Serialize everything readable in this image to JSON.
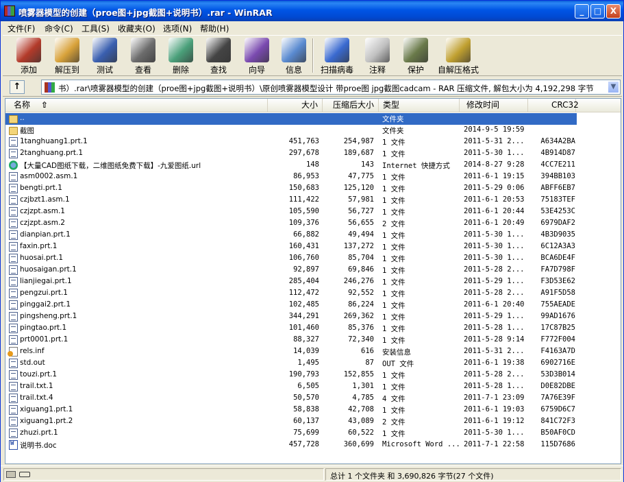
{
  "window": {
    "title": "喷雾器模型的创建（proe图+jpg截图+说明书）.rar - WinRAR",
    "min_label": "_",
    "max_label": "□",
    "close_label": "X"
  },
  "menu": [
    "文件(F)",
    "命令(C)",
    "工具(S)",
    "收藏夹(O)",
    "选项(N)",
    "帮助(H)"
  ],
  "toolbar": {
    "buttons": [
      {
        "label": "添加",
        "icon": "add-books-icon",
        "color": "#b33a2a"
      },
      {
        "label": "解压到",
        "icon": "extract-folder-icon",
        "color": "#d8a23a"
      },
      {
        "label": "测试",
        "icon": "test-clipboard-icon",
        "color": "#3a5fb0"
      },
      {
        "label": "查看",
        "icon": "view-glasses-icon",
        "color": "#6c6c6c"
      },
      {
        "label": "删除",
        "icon": "delete-box-icon",
        "color": "#4aa07a"
      },
      {
        "label": "查找",
        "icon": "find-binoculars-icon",
        "color": "#444444"
      },
      {
        "label": "向导",
        "icon": "wizard-icon",
        "color": "#7a4ab0"
      },
      {
        "label": "信息",
        "icon": "info-icon",
        "color": "#5a8ad0"
      },
      {
        "label": "扫描病毒",
        "icon": "virus-scan-icon",
        "color": "#3a6ad0"
      },
      {
        "label": "注释",
        "icon": "comment-pen-icon",
        "color": "#c0c0c0"
      },
      {
        "label": "保护",
        "icon": "protect-shield-icon",
        "color": "#6a7a4a"
      },
      {
        "label": "自解压格式",
        "icon": "sfx-books-icon",
        "color": "#c0a030"
      }
    ]
  },
  "address": {
    "path": "书）.rar\\喷雾器模型的创建（proe图+jpg截图+说明书）\\原创喷雾器模型设计 带proe图 jpg截图cadcam - RAR 压缩文件, 解包大小为 4,192,298 字节",
    "up_label": "↑",
    "dropdown_label": "▼"
  },
  "columns": {
    "name": "名称",
    "size": "大小",
    "packed": "压缩后大小",
    "type": "类型",
    "modified": "修改时间",
    "crc": "CRC32"
  },
  "files": [
    {
      "name": "..",
      "size": "",
      "packed": "",
      "type": "文件夹",
      "modified": "",
      "crc": "",
      "icon": "folder",
      "selected": true
    },
    {
      "name": "截图",
      "size": "",
      "packed": "",
      "type": "文件夹",
      "modified": "2014-9-5 19:59",
      "crc": "",
      "icon": "folder"
    },
    {
      "name": "1tanghuang1.prt.1",
      "size": "451,763",
      "packed": "254,987",
      "type": "1 文件",
      "modified": "2011-5-31 2...",
      "crc": "A634A2BA",
      "icon": "file"
    },
    {
      "name": "2tanghuang.prt.1",
      "size": "297,678",
      "packed": "189,687",
      "type": "1 文件",
      "modified": "2011-5-30 1...",
      "crc": "4B914D87",
      "icon": "file"
    },
    {
      "name": "【大量CAD图纸下载，二维图纸免费下载】-九爱图纸.url",
      "size": "148",
      "packed": "143",
      "type": "Internet 快捷方式",
      "modified": "2014-8-27 9:28",
      "crc": "4CC7E211",
      "icon": "url"
    },
    {
      "name": "asm0002.asm.1",
      "size": "86,953",
      "packed": "47,775",
      "type": "1 文件",
      "modified": "2011-6-1 19:15",
      "crc": "394BB103",
      "icon": "file"
    },
    {
      "name": "bengti.prt.1",
      "size": "150,683",
      "packed": "125,120",
      "type": "1 文件",
      "modified": "2011-5-29 0:06",
      "crc": "ABFF6EB7",
      "icon": "file"
    },
    {
      "name": "czjbzt1.asm.1",
      "size": "111,422",
      "packed": "57,981",
      "type": "1 文件",
      "modified": "2011-6-1 20:53",
      "crc": "75183TEF",
      "icon": "file"
    },
    {
      "name": "czjzpt.asm.1",
      "size": "105,590",
      "packed": "56,727",
      "type": "1 文件",
      "modified": "2011-6-1 20:44",
      "crc": "53E4253C",
      "icon": "file"
    },
    {
      "name": "czjzpt.asm.2",
      "size": "109,376",
      "packed": "56,655",
      "type": "2 文件",
      "modified": "2011-6-1 20:49",
      "crc": "6979DAF2",
      "icon": "file"
    },
    {
      "name": "dianpian.prt.1",
      "size": "66,882",
      "packed": "49,494",
      "type": "1 文件",
      "modified": "2011-5-30 1...",
      "crc": "4B3D9035",
      "icon": "file"
    },
    {
      "name": "faxin.prt.1",
      "size": "160,431",
      "packed": "137,272",
      "type": "1 文件",
      "modified": "2011-5-30 1...",
      "crc": "6C12A3A3",
      "icon": "file"
    },
    {
      "name": "huosai.prt.1",
      "size": "106,760",
      "packed": "85,704",
      "type": "1 文件",
      "modified": "2011-5-30 1...",
      "crc": "BCA6DE4F",
      "icon": "file"
    },
    {
      "name": "huosaigan.prt.1",
      "size": "92,897",
      "packed": "69,846",
      "type": "1 文件",
      "modified": "2011-5-28 2...",
      "crc": "FA7D798F",
      "icon": "file"
    },
    {
      "name": "lianjiegai.prt.1",
      "size": "285,404",
      "packed": "246,276",
      "type": "1 文件",
      "modified": "2011-5-29 1...",
      "crc": "F3D53E62",
      "icon": "file"
    },
    {
      "name": "pengzui.prt.1",
      "size": "112,472",
      "packed": "92,552",
      "type": "1 文件",
      "modified": "2011-5-28 2...",
      "crc": "A91F5D58",
      "icon": "file"
    },
    {
      "name": "pinggai2.prt.1",
      "size": "102,485",
      "packed": "86,224",
      "type": "1 文件",
      "modified": "2011-6-1 20:40",
      "crc": "755AEADE",
      "icon": "file"
    },
    {
      "name": "pingsheng.prt.1",
      "size": "344,291",
      "packed": "269,362",
      "type": "1 文件",
      "modified": "2011-5-29 1...",
      "crc": "99AD1676",
      "icon": "file"
    },
    {
      "name": "pingtao.prt.1",
      "size": "101,460",
      "packed": "85,376",
      "type": "1 文件",
      "modified": "2011-5-28 1...",
      "crc": "17C87B25",
      "icon": "file"
    },
    {
      "name": "prt0001.prt.1",
      "size": "88,327",
      "packed": "72,340",
      "type": "1 文件",
      "modified": "2011-5-28 9:14",
      "crc": "F772F004",
      "icon": "file"
    },
    {
      "name": "rels.inf",
      "size": "14,039",
      "packed": "616",
      "type": "安装信息",
      "modified": "2011-5-31 2...",
      "crc": "F4163A7D",
      "icon": "inf"
    },
    {
      "name": "std.out",
      "size": "1,495",
      "packed": "87",
      "type": "OUT 文件",
      "modified": "2011-6-1 19:38",
      "crc": "6902716E",
      "icon": "file"
    },
    {
      "name": "touzi.prt.1",
      "size": "190,793",
      "packed": "152,855",
      "type": "1 文件",
      "modified": "2011-5-28 2...",
      "crc": "53D3B014",
      "icon": "file"
    },
    {
      "name": "trail.txt.1",
      "size": "6,505",
      "packed": "1,301",
      "type": "1 文件",
      "modified": "2011-5-28 1...",
      "crc": "D0E82DBE",
      "icon": "file"
    },
    {
      "name": "trail.txt.4",
      "size": "50,570",
      "packed": "4,785",
      "type": "4 文件",
      "modified": "2011-7-1 23:09",
      "crc": "7A76E39F",
      "icon": "file"
    },
    {
      "name": "xiguang1.prt.1",
      "size": "58,838",
      "packed": "42,708",
      "type": "1 文件",
      "modified": "2011-6-1 19:03",
      "crc": "6759D6C7",
      "icon": "file"
    },
    {
      "name": "xiguang1.prt.2",
      "size": "60,137",
      "packed": "43,089",
      "type": "2 文件",
      "modified": "2011-6-1 19:12",
      "crc": "841C72F3",
      "icon": "file"
    },
    {
      "name": "zhuzi.prt.1",
      "size": "75,699",
      "packed": "60,522",
      "type": "1 文件",
      "modified": "2011-5-30 1...",
      "crc": "B50AF0CD",
      "icon": "file"
    },
    {
      "name": "说明书.doc",
      "size": "457,728",
      "packed": "360,699",
      "type": "Microsoft Word ...",
      "modified": "2011-7-1 22:58",
      "crc": "115D7686",
      "icon": "doc"
    }
  ],
  "status": {
    "summary": "总计 1 个文件夹 和 3,690,826 字节(27 个文件)"
  }
}
